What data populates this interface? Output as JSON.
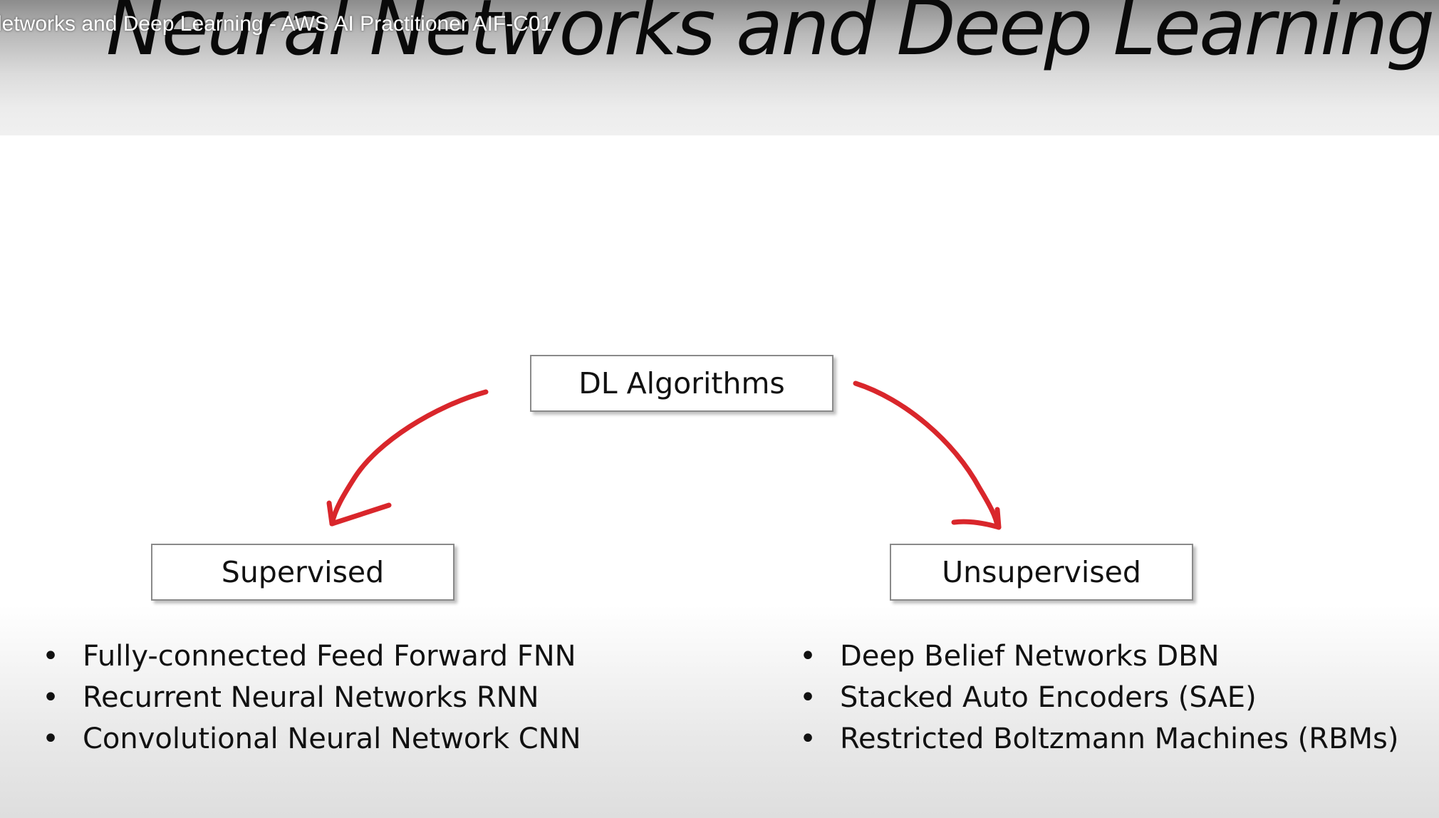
{
  "video": {
    "title": "letworks and Deep Learning - AWS AI Practitioner AIF-C01"
  },
  "slide": {
    "title": "Neural Networks and Deep Learning",
    "root_box": "DL Algorithms",
    "supervised": {
      "label": "Supervised",
      "items": [
        "Fully-connected Feed Forward FNN",
        "Recurrent Neural Networks RNN",
        "Convolutional Neural Network CNN"
      ]
    },
    "unsupervised": {
      "label": "Unsupervised",
      "items": [
        "Deep Belief Networks DBN",
        "Stacked Auto Encoders (SAE)",
        "Restricted Boltzmann Machines (RBMs)"
      ]
    },
    "bullet_char": "•"
  },
  "colors": {
    "arrow": "#d9262b",
    "box_border": "#8a8a8a",
    "text": "#111111"
  }
}
